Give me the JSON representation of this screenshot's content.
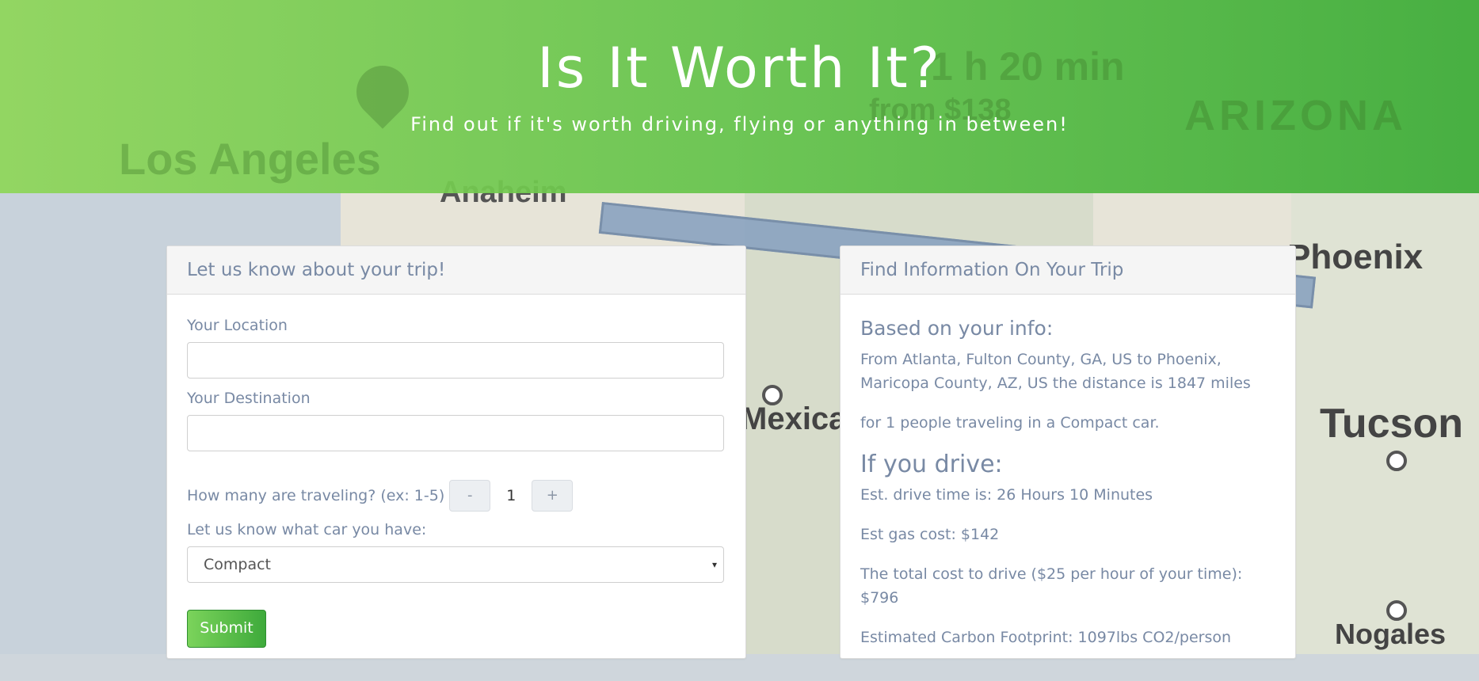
{
  "header": {
    "title": "Is It Worth It?",
    "subtitle": "Find out if it's worth driving, flying or anything in between!"
  },
  "map": {
    "labels": {
      "los_angeles": "Los Angeles",
      "anaheim": "Anaheim",
      "arizona": "ARIZONA",
      "route_time": "1 h 20 min",
      "route_price": "from $138",
      "phoenix": "Phoenix",
      "mexicali": "Mexicali",
      "tucson": "Tucson",
      "nogales": "Nogales"
    }
  },
  "form": {
    "heading": "Let us know about your trip!",
    "location_label": "Your Location",
    "location_value": "",
    "destination_label": "Your Destination",
    "destination_value": "",
    "travelers_label": "How many are traveling? (ex: 1-5)",
    "minus_label": "-",
    "travelers_value": "1",
    "plus_label": "+",
    "car_label": "Let us know what car you have:",
    "car_selected": "Compact",
    "caret": "▾",
    "submit_label": "Submit"
  },
  "results": {
    "heading": "Find Information On Your Trip",
    "based_heading": "Based on your info:",
    "route_text": "From Atlanta, Fulton County, GA, US to Phoenix, Maricopa County, AZ, US the distance is 1847 miles",
    "people_text": "for 1 people traveling in a Compact car.",
    "drive_heading": "If you drive:",
    "drive_time": "Est. drive time is: 26 Hours 10 Minutes",
    "gas_cost": "Est gas cost: $142",
    "total_cost": "The total cost to drive ($25 per hour of your time): $796",
    "carbon": "Estimated Carbon Footprint: 1097lbs CO2/person"
  }
}
